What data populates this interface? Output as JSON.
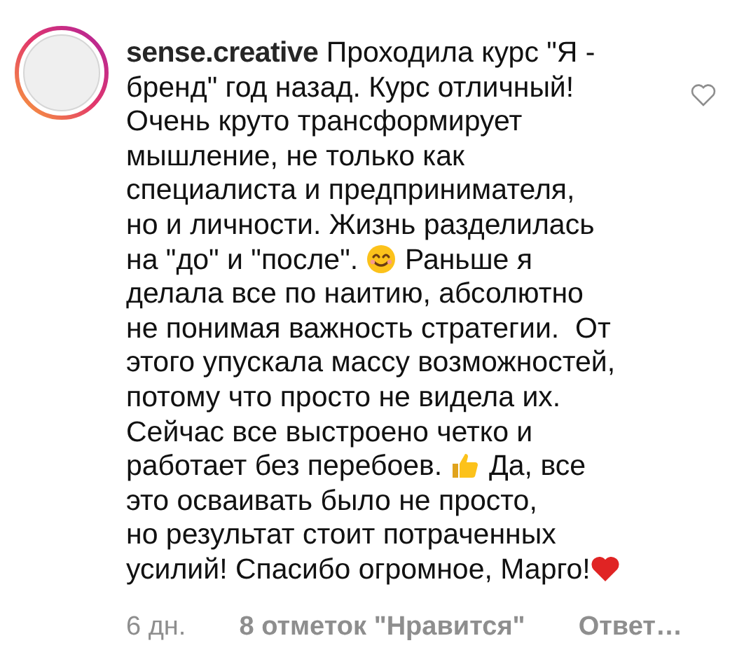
{
  "comment": {
    "username": "sense.creative",
    "lines": [
      [
        {
          "kind": "text",
          "text": "Проходила курс \"Я -"
        }
      ],
      [
        {
          "kind": "text",
          "text": "бренд\" год назад. Курс отличный!"
        }
      ],
      [
        {
          "kind": "text",
          "text": "Очень круто трансформирует"
        }
      ],
      [
        {
          "kind": "text",
          "text": "мышление, не только как"
        }
      ],
      [
        {
          "kind": "text",
          "text": "специалиста и предпринимателя,"
        }
      ],
      [
        {
          "kind": "text",
          "text": "но и личности. Жизнь разделилась"
        }
      ],
      [
        {
          "kind": "text",
          "text": "на \"до\" и \"после\". "
        },
        {
          "kind": "smiley"
        },
        {
          "kind": "text",
          "text": " Раньше я"
        }
      ],
      [
        {
          "kind": "text",
          "text": "делала все по наитию, абсолютно"
        }
      ],
      [
        {
          "kind": "text",
          "text": "не понимая важность стратегии.  От"
        }
      ],
      [
        {
          "kind": "text",
          "text": "этого упускала массу возможностей,"
        }
      ],
      [
        {
          "kind": "text",
          "text": "потому что просто не видела их."
        }
      ],
      [
        {
          "kind": "text",
          "text": "Сейчас все выстроено четко и"
        }
      ],
      [
        {
          "kind": "text",
          "text": "работает без перебоев. "
        },
        {
          "kind": "thumbsup"
        },
        {
          "kind": "text",
          "text": " Да, все"
        }
      ],
      [
        {
          "kind": "text",
          "text": "это осваивать было не просто,"
        }
      ],
      [
        {
          "kind": "text",
          "text": "но результат стоит потраченных"
        }
      ],
      [
        {
          "kind": "text",
          "text": "усилий! Спасибо огромное, Марго!"
        },
        {
          "kind": "heart"
        }
      ]
    ],
    "time": "6 дн.",
    "likes": "8 отметок \"Нравится\"",
    "reply": "Ответ…",
    "liked": false
  }
}
